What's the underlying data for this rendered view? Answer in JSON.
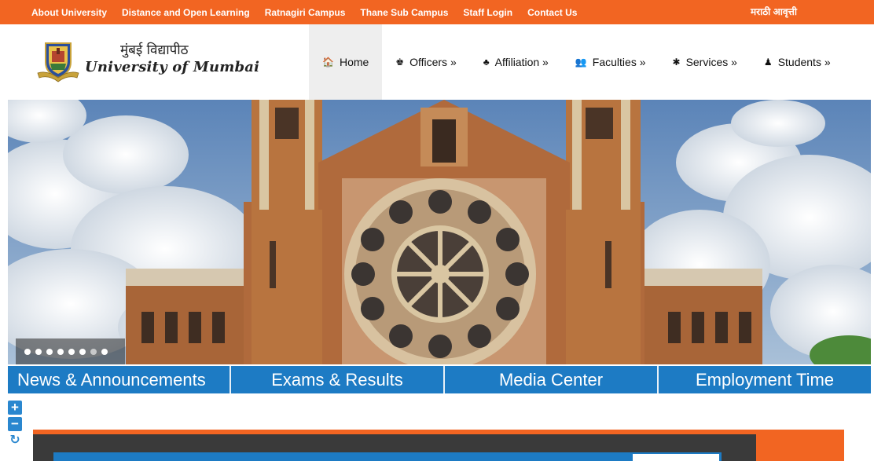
{
  "topbar": {
    "links": [
      "About University",
      "Distance and Open Learning",
      "Ratnagiri Campus",
      "Thane Sub Campus",
      "Staff Login",
      "Contact Us"
    ],
    "language": "मराठी आवृत्ती"
  },
  "logo": {
    "hindi": "मुंबई विद्यापीठ",
    "english": "University of Mumbai"
  },
  "nav": [
    {
      "label": "Home",
      "icon": "home-icon",
      "glyph": "🏠"
    },
    {
      "label": "Officers »",
      "icon": "user-tie-icon",
      "glyph": "♚"
    },
    {
      "label": "Affiliation »",
      "icon": "sitemap-icon",
      "glyph": "♣"
    },
    {
      "label": "Faculties »",
      "icon": "users-icon",
      "glyph": "👥"
    },
    {
      "label": "Services »",
      "icon": "gear-icon",
      "glyph": "✱"
    },
    {
      "label": "Students »",
      "icon": "user-icon",
      "glyph": "♟"
    }
  ],
  "tabs": [
    "News & Announcements",
    "Exams & Results",
    "Media Center",
    "Employment Time"
  ],
  "slider": {
    "count": 8,
    "active": 6
  },
  "zoom": {
    "in": "+",
    "out": "−",
    "reset": "↻"
  },
  "colors": {
    "accent": "#f26522",
    "tab": "#1d7bc4"
  }
}
